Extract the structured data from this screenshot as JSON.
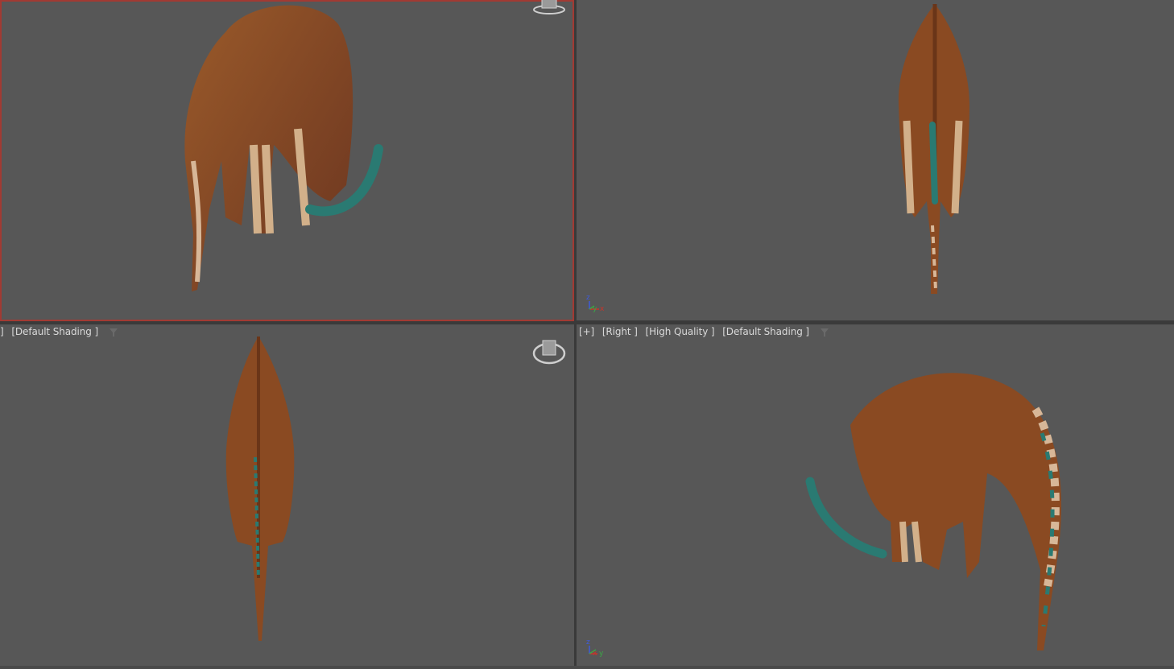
{
  "viewports": {
    "top_left": {
      "active": true
    },
    "top_right": {
      "axis": {
        "z": "z",
        "x": "x",
        "y": "y"
      }
    },
    "bottom_left": {
      "label": {
        "bracket": "]",
        "shading": "[Default Shading ]"
      }
    },
    "bottom_right": {
      "label": {
        "plus": "[+]",
        "view": "[Right ]",
        "quality": "[High Quality ]",
        "shading": "[Default Shading ]"
      },
      "axis": {
        "z": "z",
        "x": "x",
        "y": "y"
      }
    }
  },
  "colors": {
    "viewport_bg": "#575757",
    "active_border": "#a23a33",
    "model_body": "#8a4a22",
    "model_belly": "#c9a98a",
    "crest": "#2a7a72",
    "axis_x": "#c8352b",
    "axis_y": "#3aa745",
    "axis_z": "#3f5bd8"
  },
  "icons": [
    "viewcube-icon",
    "filter-icon",
    "axis-tripod-icon"
  ]
}
